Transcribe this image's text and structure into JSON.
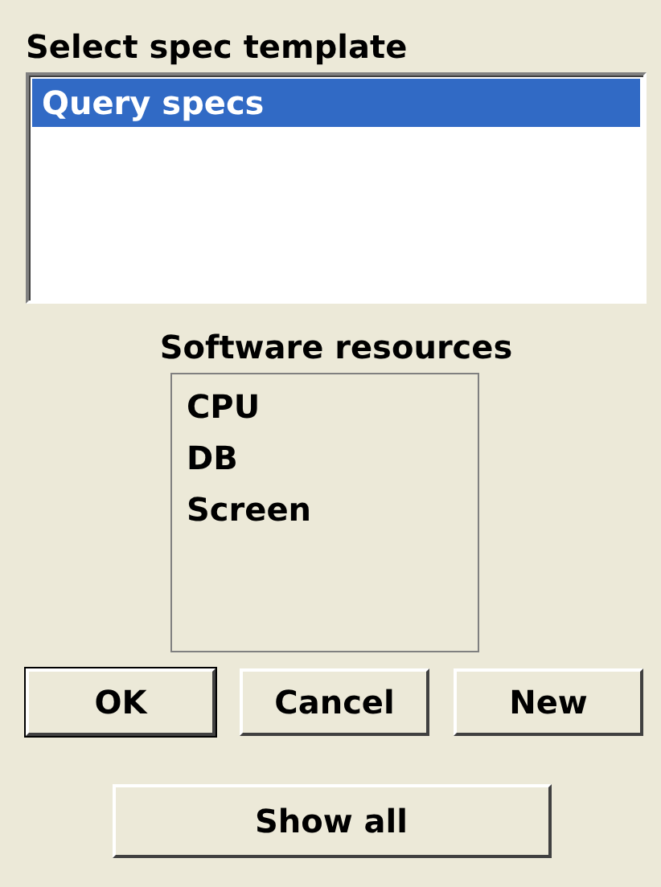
{
  "template_label": "Select spec template",
  "templates": [
    {
      "label": "Query specs",
      "selected": true
    }
  ],
  "resources_label": "Software resources",
  "resources": [
    {
      "label": "CPU",
      "selected": false
    },
    {
      "label": "DB",
      "selected": false
    },
    {
      "label": "Screen",
      "selected": false
    }
  ],
  "buttons": [
    {
      "label": "OK",
      "default": true
    },
    {
      "label": "Cancel",
      "default": false
    },
    {
      "label": "New",
      "default": false
    }
  ],
  "show_all_button": "Show all"
}
